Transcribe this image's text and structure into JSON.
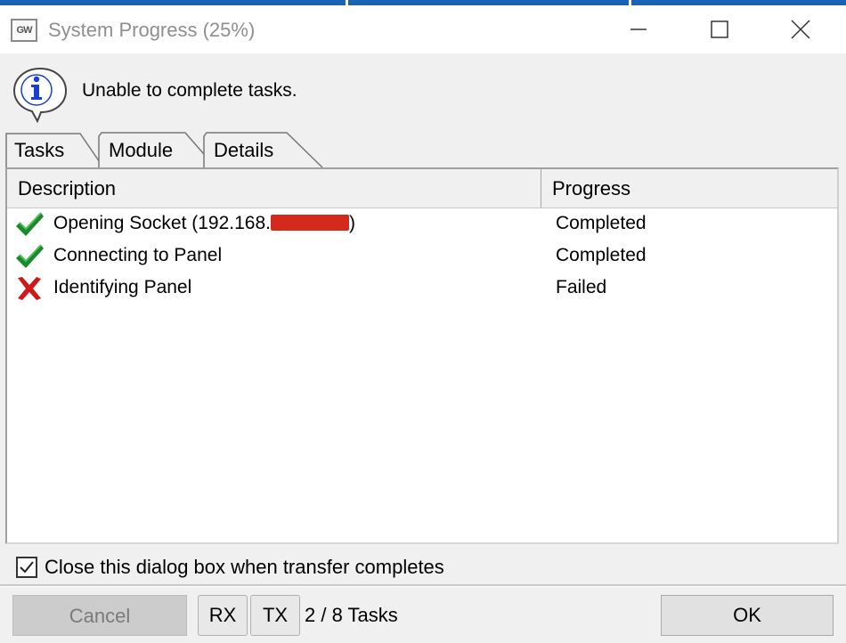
{
  "window": {
    "app_icon_text": "GW",
    "title": "System Progress (25%)"
  },
  "message": "Unable to complete tasks.",
  "tabs": [
    {
      "label": "Tasks",
      "active": true
    },
    {
      "label": "Module",
      "active": false
    },
    {
      "label": "Details",
      "active": false
    }
  ],
  "table": {
    "columns": [
      "Description",
      "Progress"
    ],
    "rows": [
      {
        "status_icon": "check-icon",
        "description_prefix": "Opening Socket (192.168.",
        "description_suffix": ")",
        "redacted": true,
        "progress": "Completed"
      },
      {
        "status_icon": "check-icon",
        "description": "Connecting to Panel",
        "progress": "Completed"
      },
      {
        "status_icon": "cross-icon",
        "description": "Identifying Panel",
        "progress": "Failed"
      }
    ]
  },
  "close_on_complete": {
    "label": "Close this dialog box when transfer completes",
    "checked": true
  },
  "footer": {
    "cancel_label": "Cancel",
    "rx_label": "RX",
    "tx_label": "TX",
    "task_count": "2 / 8 Tasks",
    "ok_label": "OK"
  },
  "colors": {
    "check": "#1b8a2a",
    "cross": "#d01818",
    "redaction": "#d42a1c",
    "info_icon": "#1a3fd6"
  }
}
